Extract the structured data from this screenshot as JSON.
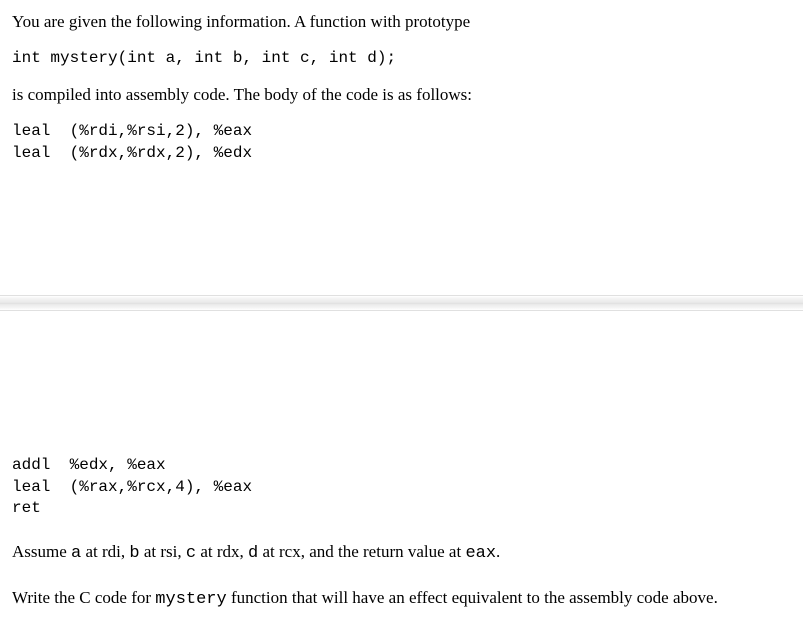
{
  "upper": {
    "intro": "You are given the following information. A function with prototype",
    "prototype": "int mystery(int a, int b, int c, int d);",
    "compiled": "is compiled into assembly code. The body of the code is as follows:",
    "asm1_line1": "leal  (%rdi,%rsi,2), %eax",
    "asm1_line2": "leal  (%rdx,%rdx,2), %edx"
  },
  "lower": {
    "asm2_line1": "addl  %edx, %eax",
    "asm2_line2": "leal  (%rax,%rcx,4), %eax",
    "asm2_line3": "ret",
    "assume_pre": "Assume ",
    "a": "a",
    "at_rdi": " at rdi, ",
    "b": "b",
    "at_rsi": " at rsi, ",
    "c": "c",
    "at_rdx": " at rdx, ",
    "d": "d",
    "at_rcx": " at rcx, and the return value at ",
    "eax": "eax",
    "period": ".",
    "write_pre": "Write the C code for ",
    "mystery": "mystery",
    "write_post": " function that will have an effect equivalent to the assembly code above."
  }
}
